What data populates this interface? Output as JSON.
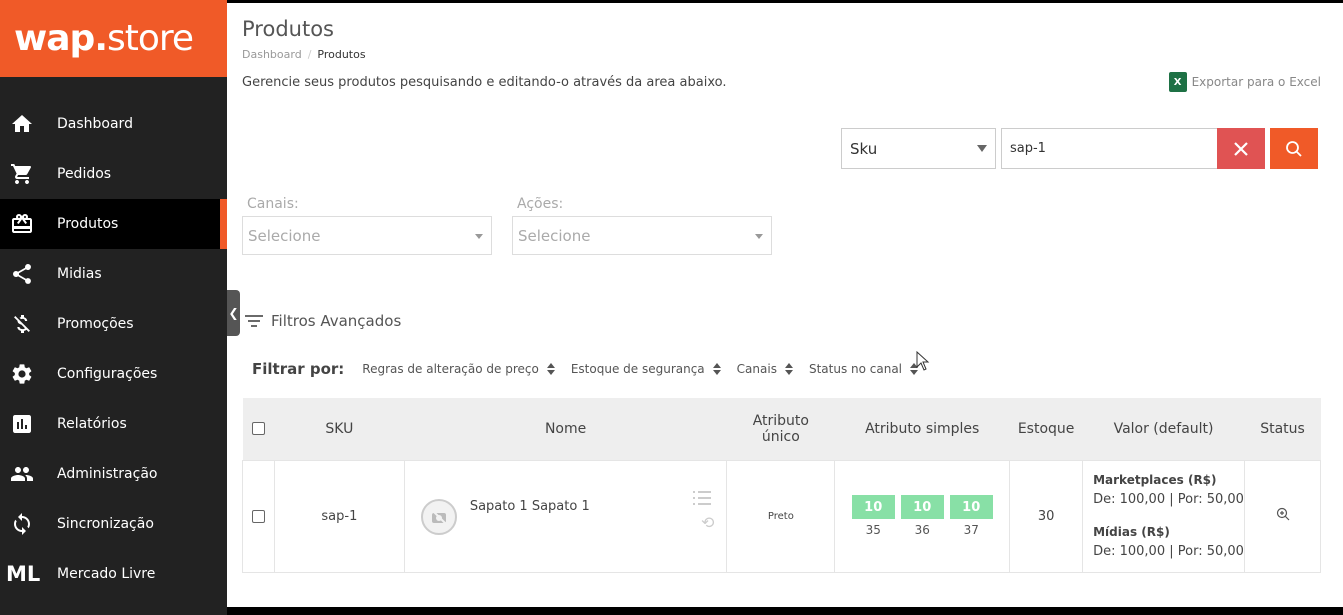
{
  "brand": {
    "logo_bold": "wap.",
    "logo_regular": "store"
  },
  "sidebar": {
    "items": [
      {
        "label": "Dashboard",
        "icon": "home-icon"
      },
      {
        "label": "Pedidos",
        "icon": "cart-icon"
      },
      {
        "label": "Produtos",
        "icon": "package-icon",
        "active": true
      },
      {
        "label": "Midias",
        "icon": "share-icon"
      },
      {
        "label": "Promoções",
        "icon": "dollar-off-icon"
      },
      {
        "label": "Configurações",
        "icon": "gear-icon"
      },
      {
        "label": "Relatórios",
        "icon": "bar-chart-icon"
      },
      {
        "label": "Administração",
        "icon": "people-icon"
      },
      {
        "label": "Sincronização",
        "icon": "sync-icon"
      },
      {
        "label": "Mercado Livre",
        "icon": "ml-icon",
        "icon_text": "ML"
      }
    ]
  },
  "header": {
    "title": "Produtos",
    "breadcrumb": {
      "root": "Dashboard",
      "separator": "/",
      "current": "Produtos"
    },
    "description": "Gerencie seus produtos pesquisando e editando-o através da area abaixo.",
    "export_label": "Exportar para o Excel",
    "export_icon_text": "X"
  },
  "search": {
    "field_selected": "Sku",
    "query": "sap-1"
  },
  "filters": {
    "canais_label": "Canais:",
    "canais_placeholder": "Selecione",
    "acoes_label": "Ações:",
    "acoes_placeholder": "Selecione",
    "advanced_label": "Filtros Avançados",
    "filter_by_label": "Filtrar por:",
    "sort_options": [
      "Regras de alteração de preço",
      "Estoque de segurança",
      "Canais",
      "Status no canal"
    ]
  },
  "table": {
    "headers": {
      "sku": "SKU",
      "name": "Nome",
      "unique_attr_line1": "Atributo",
      "unique_attr_line2": "único",
      "simple_attr": "Atributo simples",
      "stock": "Estoque",
      "value": "Valor (default)",
      "status": "Status"
    },
    "rows": [
      {
        "sku": "sap-1",
        "name": "Sapato 1 Sapato 1",
        "unique_attr": "Preto",
        "simple_attrs": [
          {
            "stock": "10",
            "size": "35"
          },
          {
            "stock": "10",
            "size": "36"
          },
          {
            "stock": "10",
            "size": "37"
          }
        ],
        "stock": "30",
        "prices": {
          "marketplaces_title": "Marketplaces (R$)",
          "marketplaces_value": "De: 100,00 | Por: 50,00",
          "midias_title": "Mídias (R$)",
          "midias_value": "De: 100,00 | Por: 50,00"
        }
      }
    ]
  },
  "colors": {
    "brand_orange": "#f05a28",
    "sidebar_bg": "#222222",
    "clear_red": "#e05353",
    "attr_green": "#88e0a6"
  }
}
